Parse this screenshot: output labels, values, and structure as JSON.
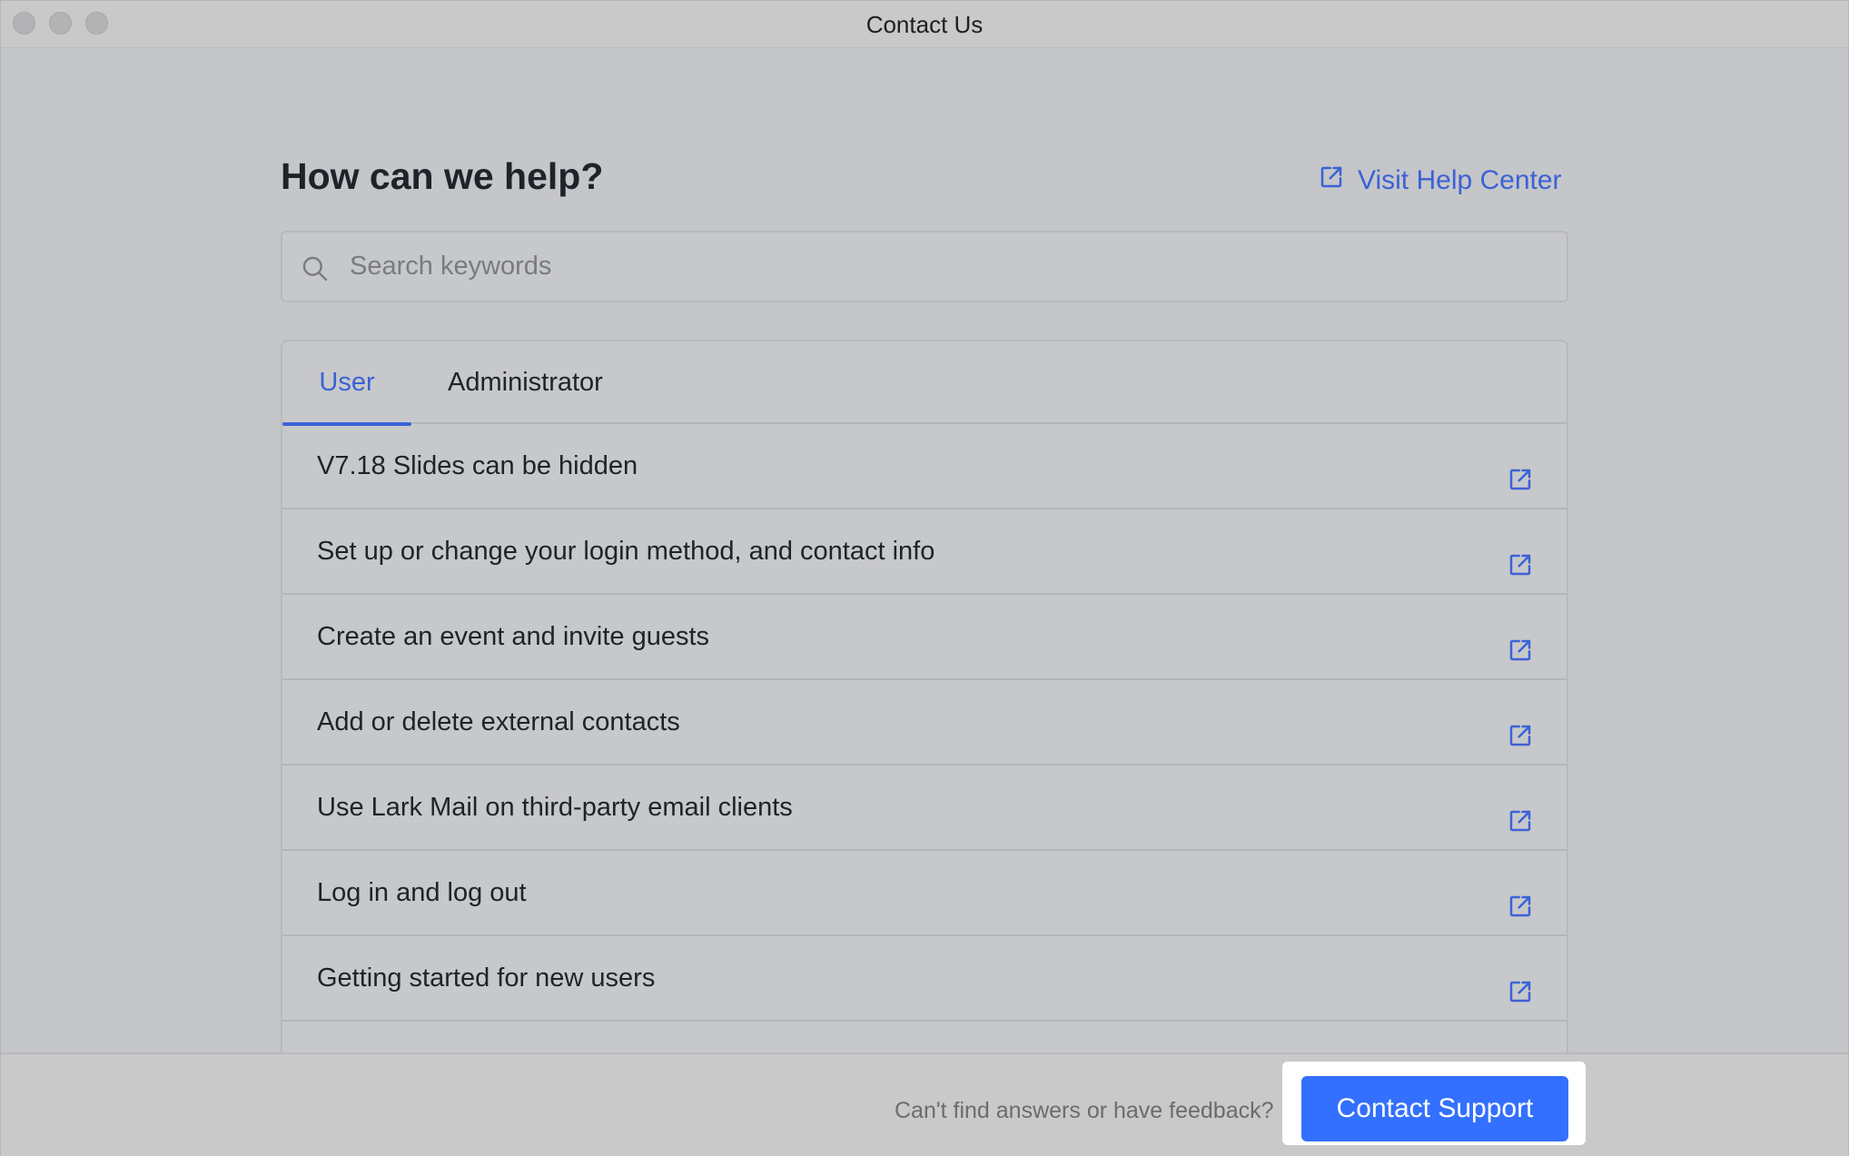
{
  "window": {
    "title": "Contact Us"
  },
  "header": {
    "heading": "How can we help?",
    "help_link": "Visit Help Center"
  },
  "search": {
    "placeholder": "Search keywords",
    "value": ""
  },
  "tabs": [
    {
      "label": "User",
      "active": true
    },
    {
      "label": "Administrator",
      "active": false
    }
  ],
  "articles": [
    "V7.18 Slides can be hidden",
    "Set up or change your login method, and contact info",
    "Create an event and invite guests",
    "Add or delete external contacts",
    "Use Lark Mail on third-party email clients",
    "Log in and log out",
    "Getting started for new users"
  ],
  "footer": {
    "prompt": "Can't find answers or have feedback?",
    "button": "Contact Support"
  },
  "colors": {
    "accent": "#3b62d6",
    "primary_button": "#3370ff"
  },
  "icons": {
    "article_link": "external-link-icon",
    "search": "search-icon"
  }
}
